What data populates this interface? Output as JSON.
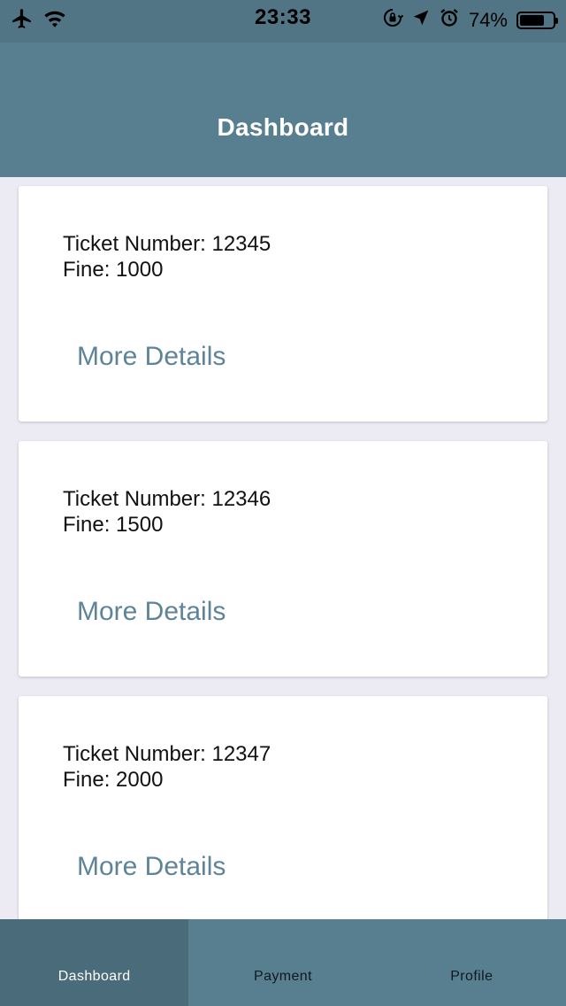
{
  "status_bar": {
    "time": "23:33",
    "battery_percent_text": "74%",
    "battery_level": 0.74,
    "icons_left": [
      "airplane-icon",
      "wifi-icon"
    ],
    "icons_right": [
      "orientation-lock-icon",
      "location-arrow-icon",
      "alarm-icon",
      "battery-icon"
    ]
  },
  "header": {
    "title": "Dashboard"
  },
  "tickets": [
    {
      "ticket_text": "Ticket Number: 12345",
      "fine_text": "Fine: 1000",
      "action_label": "More Details"
    },
    {
      "ticket_text": "Ticket Number: 12346",
      "fine_text": "Fine: 1500",
      "action_label": "More Details"
    },
    {
      "ticket_text": "Ticket Number: 12347",
      "fine_text": "Fine: 2000",
      "action_label": "More Details"
    }
  ],
  "tab_bar": {
    "tabs": [
      {
        "label": "Dashboard",
        "active": true
      },
      {
        "label": "Payment",
        "active": false
      },
      {
        "label": "Profile",
        "active": false
      }
    ]
  },
  "colors": {
    "header": "#587F90",
    "status_bar": "#527585",
    "link": "#5D8498",
    "active_tab": "#4A6B7A",
    "background": "#ECEAF2"
  }
}
